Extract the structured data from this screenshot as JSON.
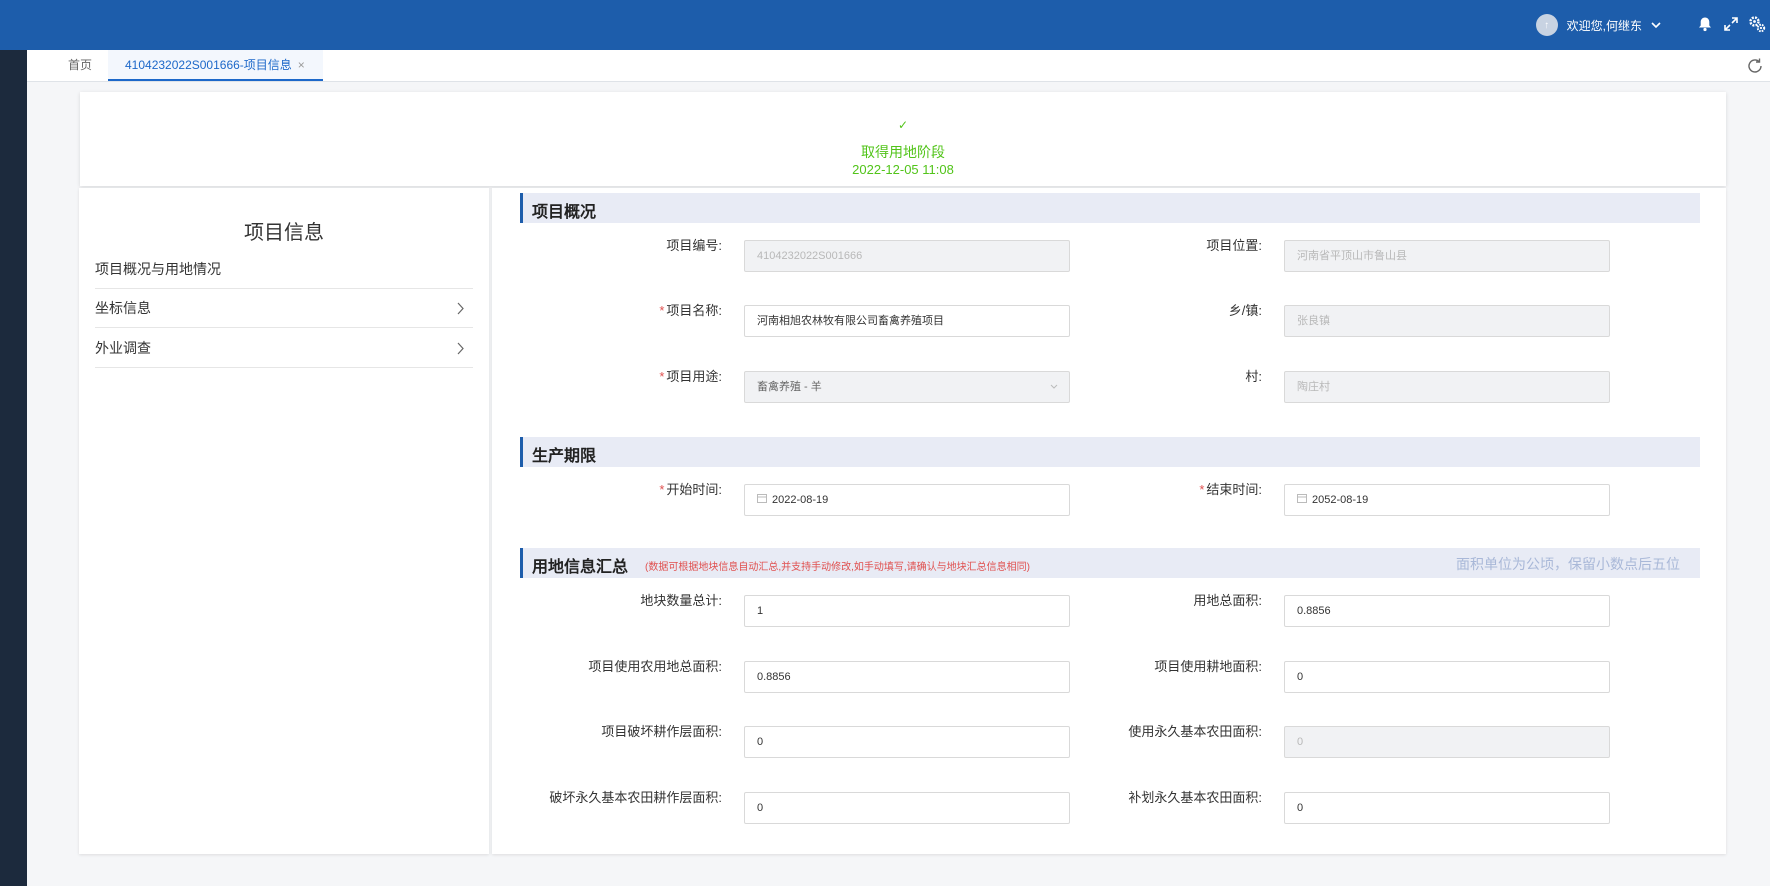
{
  "header": {
    "avatar_text": "↑",
    "welcome": "欢迎您,何继东",
    "icons": [
      "chevron-down-icon",
      "bell-icon",
      "fullscreen-icon",
      "settings-icon"
    ]
  },
  "tabs": {
    "home": "首页",
    "active": "4104232022S001666-项目信息",
    "close_symbol": "×"
  },
  "stage": {
    "check": "✓",
    "name": "取得用地阶段",
    "time": "2022-12-05 11:08",
    "color": "#52c41a"
  },
  "sidebar": {
    "title": "项目信息",
    "items": [
      {
        "label": "项目概况与用地情况",
        "has_arrow": false
      },
      {
        "label": "坐标信息",
        "has_arrow": true
      },
      {
        "label": "外业调查",
        "has_arrow": true
      }
    ],
    "arrow_symbol": "›"
  },
  "overview": {
    "title": "项目概况",
    "project_no_label": "项目编号:",
    "project_no": "4104232022S001666",
    "location_label": "项目位置:",
    "location": "河南省平顶山市鲁山县",
    "name_label": "项目名称:",
    "name": "河南相旭农林牧有限公司畜禽养殖项目",
    "town_label": "乡/镇:",
    "town": "张良镇",
    "usage_label": "项目用途:",
    "usage": "畜禽养殖 - 羊",
    "village_label": "村:",
    "village": "陶庄村"
  },
  "period": {
    "title": "生产期限",
    "start_label": "开始时间:",
    "start": "2022-08-19",
    "end_label": "结束时间:",
    "end": "2052-08-19"
  },
  "summary": {
    "title": "用地信息汇总",
    "note": "(数据可根据地块信息自动汇总,并支持手动修改,如手动填写,请确认与地块汇总信息相同)",
    "unit": "面积单位为公顷，保留小数点后五位",
    "fields": [
      {
        "label": "地块数量总计:",
        "value": "1",
        "disabled": false
      },
      {
        "label": "用地总面积:",
        "value": "0.8856",
        "disabled": false
      },
      {
        "label": "项目使用农用地总面积:",
        "value": "0.8856",
        "disabled": false
      },
      {
        "label": "项目使用耕地面积:",
        "value": "0",
        "disabled": false
      },
      {
        "label": "项目破坏耕作层面积:",
        "value": "0",
        "disabled": false
      },
      {
        "label": "使用永久基本农田面积:",
        "value": "0",
        "disabled": true
      },
      {
        "label": "破坏永久基本农田耕作层面积:",
        "value": "0",
        "disabled": false
      },
      {
        "label": "补划永久基本农田面积:",
        "value": "0",
        "disabled": false
      }
    ]
  },
  "required_mark": "*",
  "accent_color": "#1d5dab"
}
